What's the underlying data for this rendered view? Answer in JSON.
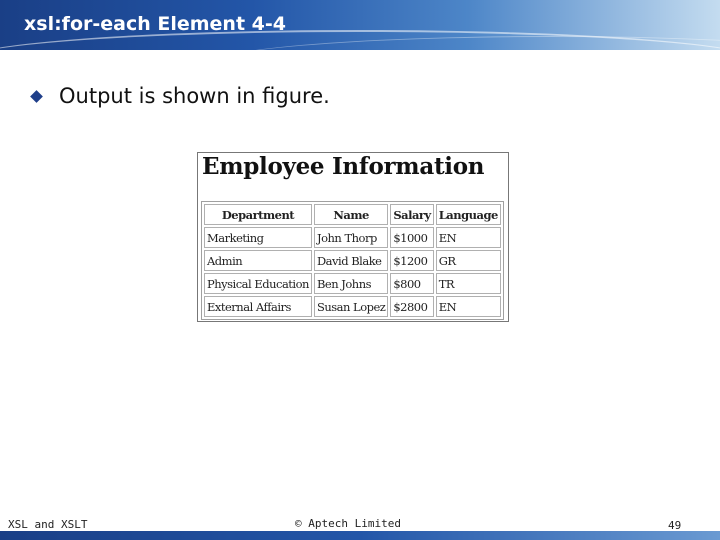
{
  "slide": {
    "title": "xsl:for-each Element 4-4",
    "bullet": "Output is shown in figure."
  },
  "figure": {
    "title": "Employee Information",
    "headers": [
      "Department",
      "Name",
      "Salary",
      "Language"
    ],
    "rows": [
      [
        "Marketing",
        "John Thorp",
        "$1000",
        "EN"
      ],
      [
        "Admin",
        "David Blake",
        "$1200",
        "GR"
      ],
      [
        "Physical Education",
        "Ben Johns",
        "$800",
        "TR"
      ],
      [
        "External Affairs",
        "Susan Lopez",
        "$2800",
        "EN"
      ]
    ]
  },
  "footer": {
    "left": "XSL and XSLT",
    "center": "© Aptech Limited",
    "page": "49"
  },
  "colors": {
    "header_dark": "#1a3f86",
    "header_light": "#c4dcf0",
    "bullet": "#1f3f8a"
  },
  "icons": {
    "bullet": "diamond-bullet-icon"
  }
}
